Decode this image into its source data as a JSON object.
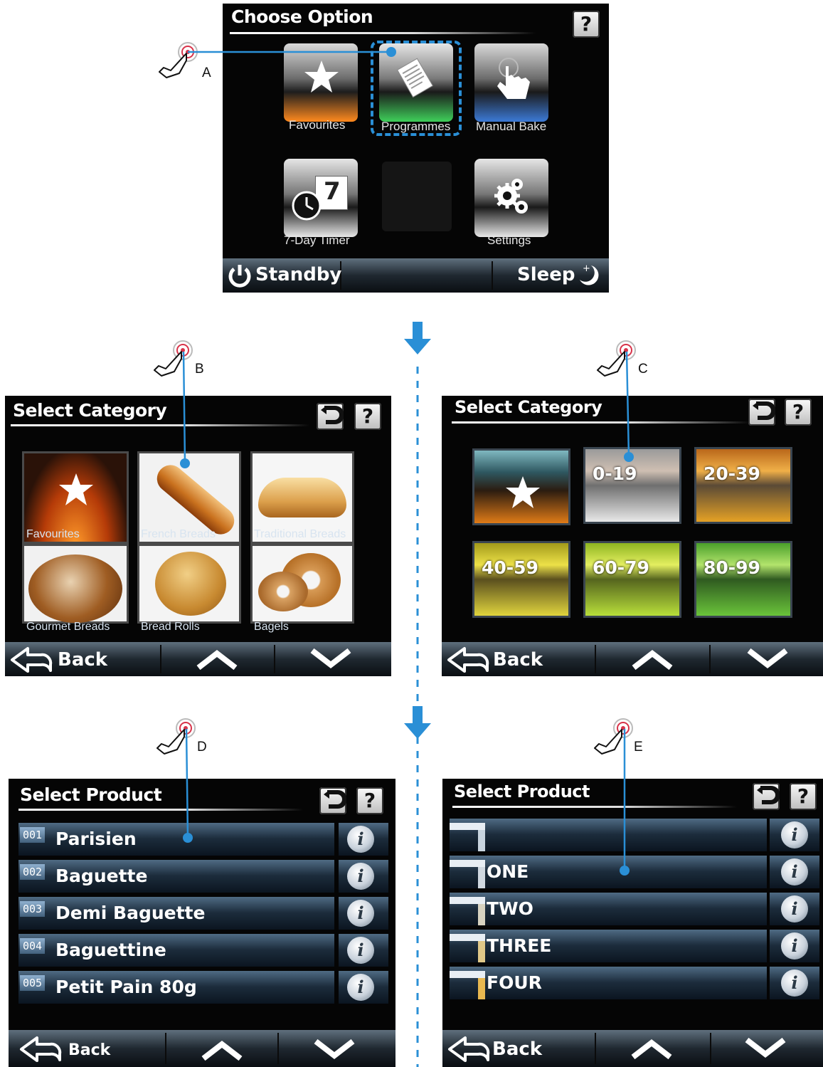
{
  "screen_a": {
    "title": "Choose Option",
    "help": "?",
    "options": [
      "Favourites",
      "Programmes",
      "Manual Bake",
      "7-Day Timer",
      "Settings"
    ],
    "timer_digit": "7",
    "footer": {
      "standby": "Standby",
      "sleep": "Sleep"
    },
    "callout": "A"
  },
  "screen_b": {
    "title": "Select Category",
    "help": "?",
    "categories": [
      "Favourites",
      "French Breads",
      "Traditional Breads",
      "Gourmet Breads",
      "Bread Rolls",
      "Bagels"
    ],
    "footer": {
      "back": "Back"
    },
    "callout": "B"
  },
  "screen_c": {
    "title": "Select Category",
    "help": "?",
    "ranges": [
      "0-19",
      "20-39",
      "40-59",
      "60-79",
      "80-99"
    ],
    "footer": {
      "back": "Back"
    },
    "callout": "C"
  },
  "screen_d": {
    "title": "Select Product",
    "help": "?",
    "products": [
      {
        "num": "001",
        "name": "Parisien"
      },
      {
        "num": "002",
        "name": "Baguette"
      },
      {
        "num": "003",
        "name": "Demi Baguette"
      },
      {
        "num": "004",
        "name": "Baguettine"
      },
      {
        "num": "005",
        "name": "Petit Pain 80g"
      }
    ],
    "info_glyph": "i",
    "footer": {
      "back": "Back"
    },
    "callout": "D"
  },
  "screen_e": {
    "title": "Select Product",
    "help": "?",
    "products": [
      "",
      "ONE",
      "TWO",
      "THREE",
      "FOUR"
    ],
    "info_glyph": "i",
    "footer": {
      "back": "Back"
    },
    "callout": "E"
  },
  "colors": {
    "arrow": "#2a8fd6",
    "callout_line": "#2a8fd6",
    "highlight": "#2a8fd6"
  },
  "icons": [
    "star-icon",
    "document-icon",
    "pointing-hand-icon",
    "clock-calendar-icon",
    "gears-icon",
    "power-icon",
    "moon-icon",
    "back-arrow-icon",
    "chevron-up-icon",
    "chevron-down-icon",
    "undo-icon",
    "info-icon",
    "touch-hand-icon",
    "down-arrow-icon"
  ]
}
